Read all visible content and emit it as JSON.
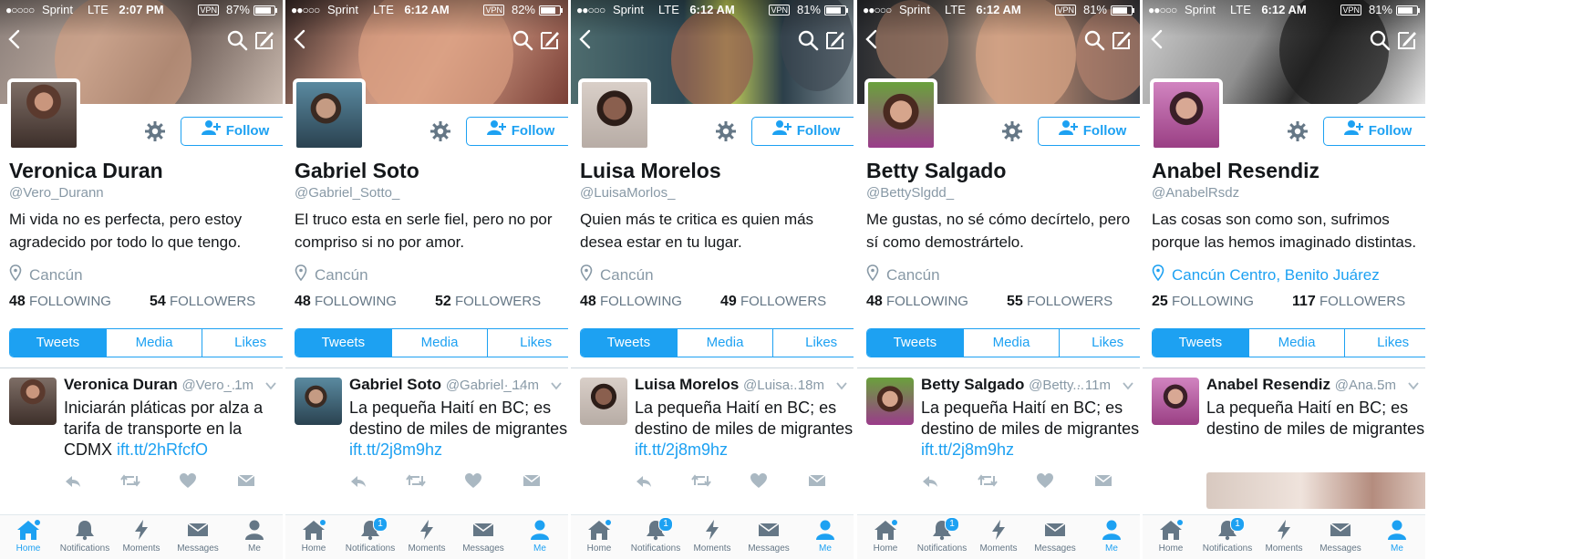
{
  "tab_labels": [
    "Tweets",
    "Media",
    "Likes"
  ],
  "follow_label": "Follow",
  "following_label": "FOLLOWING",
  "followers_label": "FOLLOWERS",
  "tabbar_labels": [
    "Home",
    "Notifications",
    "Moments",
    "Messages",
    "Me"
  ],
  "accent_color": "#1da1f2",
  "icons": [
    "back-icon",
    "search-icon",
    "compose-icon",
    "gear-icon",
    "add-person-icon",
    "location-pin-icon",
    "reply-icon",
    "retweet-icon",
    "like-icon",
    "dm-icon",
    "chevron-down-icon",
    "home-icon",
    "bell-icon",
    "lightning-icon",
    "envelope-icon",
    "person-icon"
  ],
  "panels": [
    {
      "status": {
        "carrier": "Sprint",
        "network": "LTE",
        "time": "2:07 PM",
        "battery": "87%",
        "battery_level": 0.87,
        "vpn": "VPN",
        "signal_dots": "●○○○○"
      },
      "profile": {
        "name": "Veronica Duran",
        "handle": "@Vero_Durann",
        "bio": "Mi vida no es perfecta, pero estoy agradecido por todo lo que tengo.",
        "location": "Cancún",
        "following": "48",
        "followers": "54"
      },
      "tweet": {
        "name": "Veronica Duran",
        "handle": "@Vero_...",
        "time": "· 1m",
        "text": "Iniciarán pláticas por alza a tarifa de transporte en la CDMX ",
        "link": "ift.tt/2hRfcfO"
      },
      "tabbar": {
        "active": "Home",
        "notification_count": ""
      }
    },
    {
      "status": {
        "carrier": "Sprint",
        "network": "LTE",
        "time": "6:12 AM",
        "battery": "82%",
        "battery_level": 0.82,
        "vpn": "VPN",
        "signal_dots": "●●○○○"
      },
      "profile": {
        "name": "Gabriel Soto",
        "handle": "@Gabriel_Sotto_",
        "bio": "El truco esta en serle fiel, pero no por compriso si no por amor.",
        "location": "Cancún",
        "following": "48",
        "followers": "52"
      },
      "tweet": {
        "name": "Gabriel Soto",
        "handle": "@Gabriel_...",
        "time": "· 14m",
        "text": "La pequeña Haití en BC; es destino de miles de migrantes ",
        "link": "ift.tt/2j8m9hz"
      },
      "tabbar": {
        "active": "Me",
        "notification_count": "1"
      }
    },
    {
      "status": {
        "carrier": "Sprint",
        "network": "LTE",
        "time": "6:12 AM",
        "battery": "81%",
        "battery_level": 0.81,
        "vpn": "VPN",
        "signal_dots": "●●○○○"
      },
      "profile": {
        "name": "Luisa Morelos",
        "handle": "@LuisaMorlos_",
        "bio": "Quien más te critica es quien más desea estar en tu lugar.",
        "location": "Cancún",
        "following": "48",
        "followers": "49"
      },
      "tweet": {
        "name": "Luisa Morelos",
        "handle": "@Luisa...",
        "time": "· 18m",
        "text": "La pequeña Haití en BC; es destino de miles de migrantes ",
        "link": "ift.tt/2j8m9hz"
      },
      "tabbar": {
        "active": "Me",
        "notification_count": "1"
      }
    },
    {
      "status": {
        "carrier": "Sprint",
        "network": "LTE",
        "time": "6:12 AM",
        "battery": "81%",
        "battery_level": 0.81,
        "vpn": "VPN",
        "signal_dots": "●●○○○"
      },
      "profile": {
        "name": "Betty Salgado",
        "handle": "@BettySlgdd_",
        "bio": "Me gustas, no sé cómo decírtelo, pero sí como demostrártelo.",
        "location": "Cancún",
        "following": "48",
        "followers": "55"
      },
      "tweet": {
        "name": "Betty Salgado",
        "handle": "@Betty...",
        "time": "· 11m",
        "text": "La pequeña Haití en BC; es destino de miles de migrantes ",
        "link": "ift.tt/2j8m9hz"
      },
      "tabbar": {
        "active": "Me",
        "notification_count": "1"
      }
    },
    {
      "status": {
        "carrier": "Sprint",
        "network": "LTE",
        "time": "6:12 AM",
        "battery": "81%",
        "battery_level": 0.81,
        "vpn": "VPN",
        "signal_dots": "●●○○○"
      },
      "profile": {
        "name": "Anabel Resendiz",
        "handle": "@AnabelRsdz",
        "bio": "Las cosas son como son, sufrimos porque las hemos imaginado distintas.",
        "location": "Cancún Centro, Benito Juárez",
        "following": "25",
        "followers": "117"
      },
      "tweet": {
        "name": "Anabel Resendiz",
        "handle": "@Ana...",
        "time": "· 5m",
        "text": "La pequeña Haití en BC; es destino de miles de migrantes",
        "link": ""
      },
      "tabbar": {
        "active": "Me",
        "notification_count": "1"
      }
    }
  ]
}
